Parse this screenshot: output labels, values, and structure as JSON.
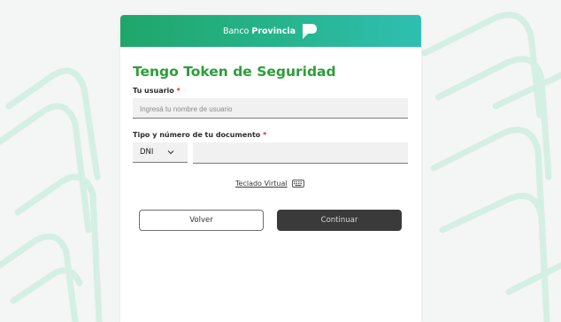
{
  "header": {
    "brand_prefix": "Banco",
    "brand_bold": "Provincia",
    "logo_icon": "banco-provincia-p-logo",
    "gradient_start": "#1fa66a",
    "gradient_end": "#2fbfb2"
  },
  "form": {
    "title": "Tengo Token de Seguridad",
    "user_label": "Tu usuario",
    "required_mark": "*",
    "user_placeholder": "Ingresá tu nombre de usuario",
    "user_value": "",
    "doc_label": "Tipo y número de tu documento",
    "doc_type_selected": "DNI",
    "doc_number_value": "",
    "virtual_keyboard_label": "Teclado Virtual"
  },
  "buttons": {
    "back_label": "Volver",
    "continue_label": "Continuar"
  },
  "colors": {
    "title": "#2c9e3a",
    "required": "#e0262b",
    "continue_bg": "#3a3a3a"
  }
}
